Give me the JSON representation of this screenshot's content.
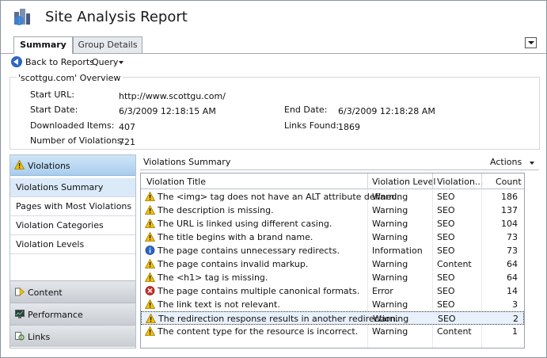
{
  "app": {
    "title": "Site Analysis Report"
  },
  "tabs": [
    {
      "label": "Summary",
      "selected": true
    },
    {
      "label": "Group Details",
      "selected": false
    }
  ],
  "toolbar": {
    "back_label": "Back to Reports",
    "query_label": "Query"
  },
  "overview": {
    "title": "'scottgu.com' Overview",
    "fields": {
      "start_url": {
        "label": "Start URL:",
        "value": "http://www.scottgu.com/"
      },
      "start_date": {
        "label": "Start Date:",
        "value": "6/3/2009 12:18:15 AM"
      },
      "end_date": {
        "label": "End Date:",
        "value": "6/3/2009 12:18:28 AM"
      },
      "downloaded": {
        "label": "Downloaded Items:",
        "value": "407"
      },
      "links_found": {
        "label": "Links Found:",
        "value": "1869"
      },
      "violations": {
        "label": "Number of Violations:",
        "value": "721"
      }
    }
  },
  "left_nav": {
    "header": "Violations",
    "items": [
      {
        "label": "Violations Summary",
        "selected": true
      },
      {
        "label": "Pages with Most Violations",
        "selected": false
      },
      {
        "label": "Violation Categories",
        "selected": false
      },
      {
        "label": "Violation Levels",
        "selected": false
      }
    ],
    "groups": [
      {
        "label": "Content",
        "icon": "content-icon"
      },
      {
        "label": "Performance",
        "icon": "performance-icon"
      },
      {
        "label": "Links",
        "icon": "links-icon"
      }
    ]
  },
  "pane": {
    "title": "Violations Summary",
    "actions_label": "Actions"
  },
  "grid": {
    "columns": [
      "Violation Title",
      "Violation Level",
      "Violation...",
      "Count"
    ],
    "rows": [
      {
        "title": "The <img> tag does not have an ALT attribute defined.",
        "level": "Warning",
        "category": "SEO",
        "count": "186",
        "icon": "warning"
      },
      {
        "title": "The description is missing.",
        "level": "Warning",
        "category": "SEO",
        "count": "137",
        "icon": "warning"
      },
      {
        "title": "The URL is linked using different casing.",
        "level": "Warning",
        "category": "SEO",
        "count": "104",
        "icon": "warning"
      },
      {
        "title": "The title begins with a brand name.",
        "level": "Warning",
        "category": "SEO",
        "count": "73",
        "icon": "warning"
      },
      {
        "title": "The page contains unnecessary redirects.",
        "level": "Information",
        "category": "SEO",
        "count": "73",
        "icon": "info"
      },
      {
        "title": "The page contains invalid markup.",
        "level": "Warning",
        "category": "Content",
        "count": "64",
        "icon": "warning"
      },
      {
        "title": "The <h1> tag is missing.",
        "level": "Warning",
        "category": "SEO",
        "count": "64",
        "icon": "warning"
      },
      {
        "title": "The page contains multiple canonical formats.",
        "level": "Error",
        "category": "SEO",
        "count": "14",
        "icon": "error"
      },
      {
        "title": "The link text is not relevant.",
        "level": "Warning",
        "category": "SEO",
        "count": "3",
        "icon": "warning"
      },
      {
        "title": "The redirection response results in another redirection.",
        "level": "Warning",
        "category": "SEO",
        "count": "2",
        "icon": "warning",
        "selected": true
      },
      {
        "title": "The content type for the resource is incorrect.",
        "level": "Warning",
        "category": "Content",
        "count": "1",
        "icon": "warning"
      }
    ]
  },
  "colors": {
    "nav_header": "#a9cdee",
    "selected_nav": "#dbeaf8",
    "warning": "#f2c200",
    "info": "#2b66c4",
    "error": "#c8302c"
  }
}
